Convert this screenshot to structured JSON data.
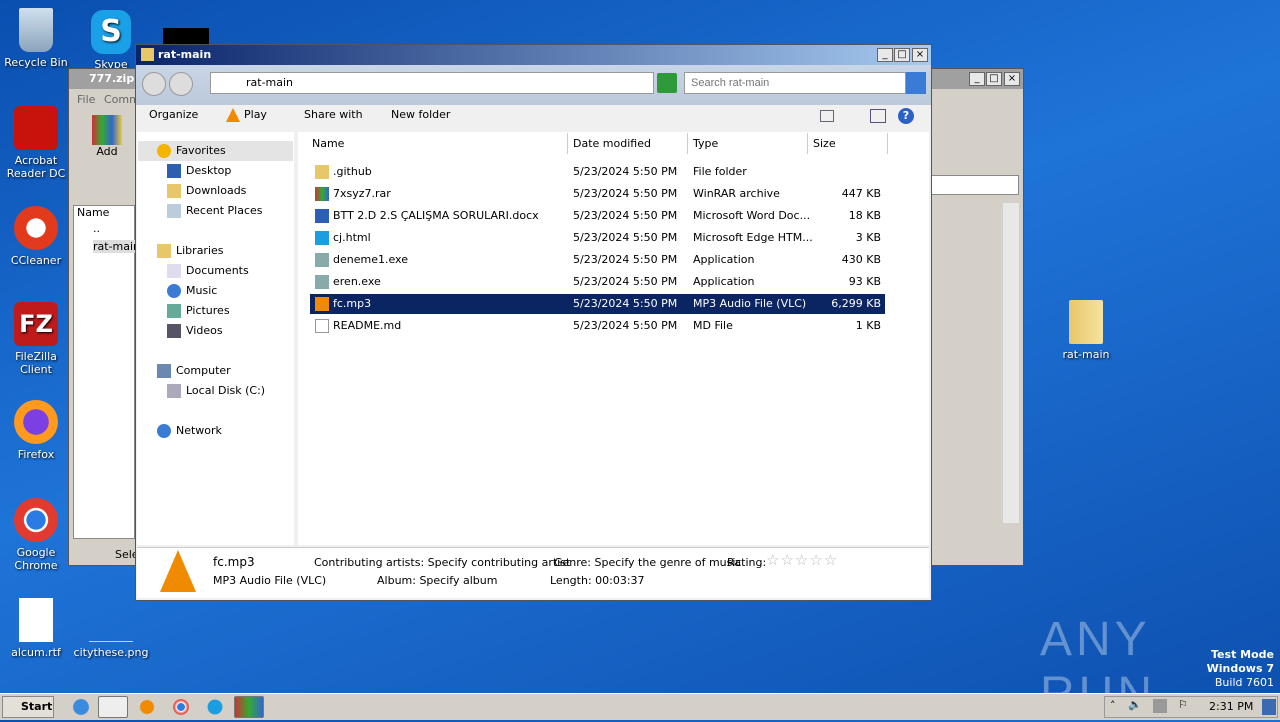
{
  "desktop": {
    "icons": [
      "Recycle Bin",
      "Skype",
      "Acrobat Reader DC",
      "CCleaner",
      "FileZilla Client",
      "Firefox",
      "Google Chrome",
      "alcum.rtf",
      "citythese.png",
      "rat-main"
    ],
    "watermark": "ANY RUN",
    "test_mode": "Test Mode",
    "os": "Windows 7",
    "build": "Build 7601"
  },
  "bg_window": {
    "title": "777.zip",
    "menu": [
      "File",
      "Comm"
    ],
    "add": "Add",
    "col_name": "Name",
    "items": [
      "..",
      "rat-main"
    ],
    "status": "Sele"
  },
  "explorer": {
    "title": "rat-main",
    "address": "rat-main",
    "search_placeholder": "Search rat-main",
    "toolbar": {
      "organize": "Organize",
      "play": "Play",
      "share": "Share with",
      "new_folder": "New folder"
    },
    "nav": {
      "favorites": "Favorites",
      "desktop": "Desktop",
      "downloads": "Downloads",
      "recent": "Recent Places",
      "libraries": "Libraries",
      "documents": "Documents",
      "music": "Music",
      "pictures": "Pictures",
      "videos": "Videos",
      "computer": "Computer",
      "local_disk": "Local Disk (C:)",
      "network": "Network"
    },
    "columns": [
      "Name",
      "Date modified",
      "Type",
      "Size"
    ],
    "files": [
      {
        "name": ".github",
        "date": "5/23/2024 5:50 PM",
        "type": "File folder",
        "size": "",
        "icon": "folder"
      },
      {
        "name": "7xsyz7.rar",
        "date": "5/23/2024 5:50 PM",
        "type": "WinRAR archive",
        "size": "447 KB",
        "icon": "rar"
      },
      {
        "name": "BTT 2.D 2.S ÇALIŞMA SORULARI.docx",
        "date": "5/23/2024 5:50 PM",
        "type": "Microsoft Word Doc...",
        "size": "18 KB",
        "icon": "word"
      },
      {
        "name": "cj.html",
        "date": "5/23/2024 5:50 PM",
        "type": "Microsoft Edge HTM...",
        "size": "3 KB",
        "icon": "edge"
      },
      {
        "name": "deneme1.exe",
        "date": "5/23/2024 5:50 PM",
        "type": "Application",
        "size": "430 KB",
        "icon": "exe"
      },
      {
        "name": "eren.exe",
        "date": "5/23/2024 5:50 PM",
        "type": "Application",
        "size": "93 KB",
        "icon": "exe"
      },
      {
        "name": "fc.mp3",
        "date": "5/23/2024 5:50 PM",
        "type": "MP3 Audio File (VLC)",
        "size": "6,299 KB",
        "icon": "vlc"
      },
      {
        "name": "README.md",
        "date": "5/23/2024 5:50 PM",
        "type": "MD File",
        "size": "1 KB",
        "icon": "file"
      }
    ],
    "selected_index": 6,
    "details": {
      "name": "fc.mp3",
      "type": "MP3 Audio File (VLC)",
      "artists": "Contributing artists: Specify contributing artist",
      "album": "Album: Specify album",
      "genre": "Genre: Specify the genre of music",
      "length": "Length: 00:03:37",
      "rating_label": "Rating:",
      "rating": 0
    }
  },
  "taskbar": {
    "start": "Start",
    "time": "2:31 PM"
  }
}
